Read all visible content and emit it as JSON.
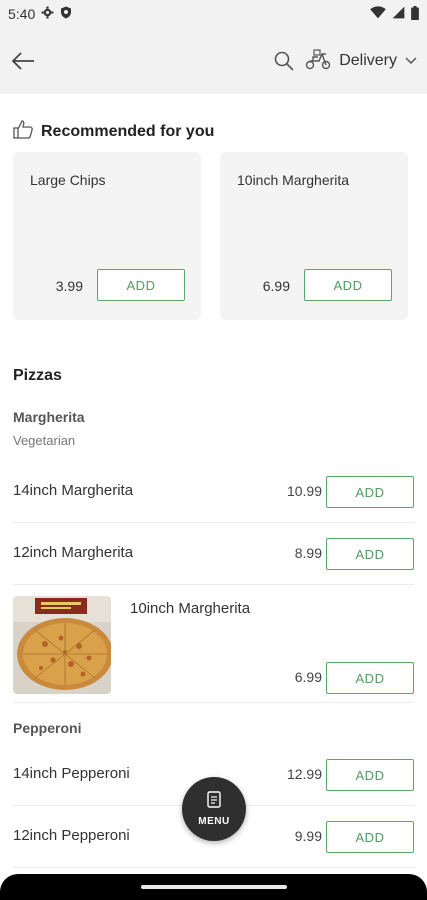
{
  "status_bar": {
    "time": "5:40"
  },
  "app_bar": {
    "delivery_label": "Delivery"
  },
  "recommended": {
    "title": "Recommended for you",
    "items": [
      {
        "name": "Large Chips",
        "price": "3.99",
        "add_label": "ADD"
      },
      {
        "name": "10inch Margherita",
        "price": "6.99",
        "add_label": "ADD"
      }
    ]
  },
  "pizzas": {
    "title": "Pizzas",
    "groups": [
      {
        "title": "Margherita",
        "subtitle": "Vegetarian",
        "items": [
          {
            "name": "14inch Margherita",
            "price": "10.99",
            "add_label": "ADD"
          },
          {
            "name": "12inch Margherita",
            "price": "8.99",
            "add_label": "ADD"
          },
          {
            "name": "10inch Margherita",
            "price": "6.99",
            "add_label": "ADD"
          }
        ]
      },
      {
        "title": "Pepperoni",
        "items": [
          {
            "name": "14inch Pepperoni",
            "price": "12.99",
            "add_label": "ADD"
          },
          {
            "name": "12inch Pepperoni",
            "price": "9.99",
            "add_label": "ADD"
          }
        ]
      }
    ]
  },
  "menu_fab": {
    "label": "MENU"
  },
  "colors": {
    "accent": "#5aa869",
    "fab": "#2f2f2f",
    "card_bg": "#f4f4f4",
    "app_bar_bg": "#f2f2f2"
  }
}
